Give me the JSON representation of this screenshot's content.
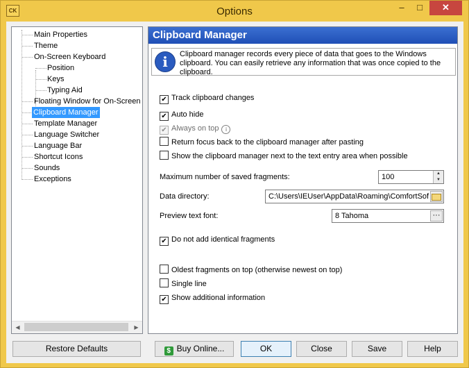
{
  "window": {
    "title": "Options",
    "icon_text": "CK",
    "controls": {
      "minimize": "–",
      "maximize": "□",
      "close": "✕"
    }
  },
  "tree": {
    "items": [
      {
        "label": "Main Properties"
      },
      {
        "label": "Theme"
      },
      {
        "label": "On-Screen Keyboard"
      },
      {
        "label": "Position"
      },
      {
        "label": "Keys"
      },
      {
        "label": "Typing Aid"
      },
      {
        "label": "Floating Window for On-Screen Ke"
      },
      {
        "label": "Clipboard Manager",
        "selected": true
      },
      {
        "label": "Template Manager"
      },
      {
        "label": "Language Switcher"
      },
      {
        "label": "Language Bar"
      },
      {
        "label": "Shortcut Icons"
      },
      {
        "label": "Sounds"
      },
      {
        "label": "Exceptions"
      }
    ],
    "scroll_left": "◀",
    "scroll_right": "▶"
  },
  "panel": {
    "title": "Clipboard Manager",
    "info_icon": "i",
    "info_text": "Clipboard manager records every piece of data that goes to the Windows clipboard. You can easily retrieve any information that was once copied to the clipboard.",
    "options": {
      "track_changes": {
        "label": "Track clipboard changes",
        "checked": true
      },
      "auto_hide": {
        "label": "Auto hide",
        "checked": true
      },
      "always_on_top": {
        "label": "Always on top",
        "checked": true,
        "disabled": true
      },
      "help_mark": "i",
      "return_focus": {
        "label": "Return focus back to the clipboard manager after pasting",
        "checked": false
      },
      "show_next_to_entry": {
        "label": "Show the clipboard manager next to the text entry area when possible",
        "checked": false
      },
      "no_identical": {
        "label": "Do not add identical fragments",
        "checked": true
      },
      "oldest_on_top": {
        "label": "Oldest fragments on top (otherwise newest on top)",
        "checked": false
      },
      "single_line": {
        "label": "Single line",
        "checked": false
      },
      "show_additional": {
        "label": "Show additional information",
        "checked": true
      }
    },
    "max_fragments": {
      "label": "Maximum number of saved fragments:",
      "value": "100",
      "up": "▲",
      "down": "▼"
    },
    "data_directory": {
      "label": "Data directory:",
      "value": "C:\\Users\\IEUser\\AppData\\Roaming\\ComfortSof"
    },
    "preview_font": {
      "label": "Preview text font:",
      "value": "8 Tahoma",
      "button": "···"
    }
  },
  "buttons": {
    "restore_defaults": "Restore Defaults",
    "buy_online": "Buy Online...",
    "buy_icon": "$",
    "ok": "OK",
    "close": "Close",
    "save": "Save",
    "help": "Help"
  }
}
